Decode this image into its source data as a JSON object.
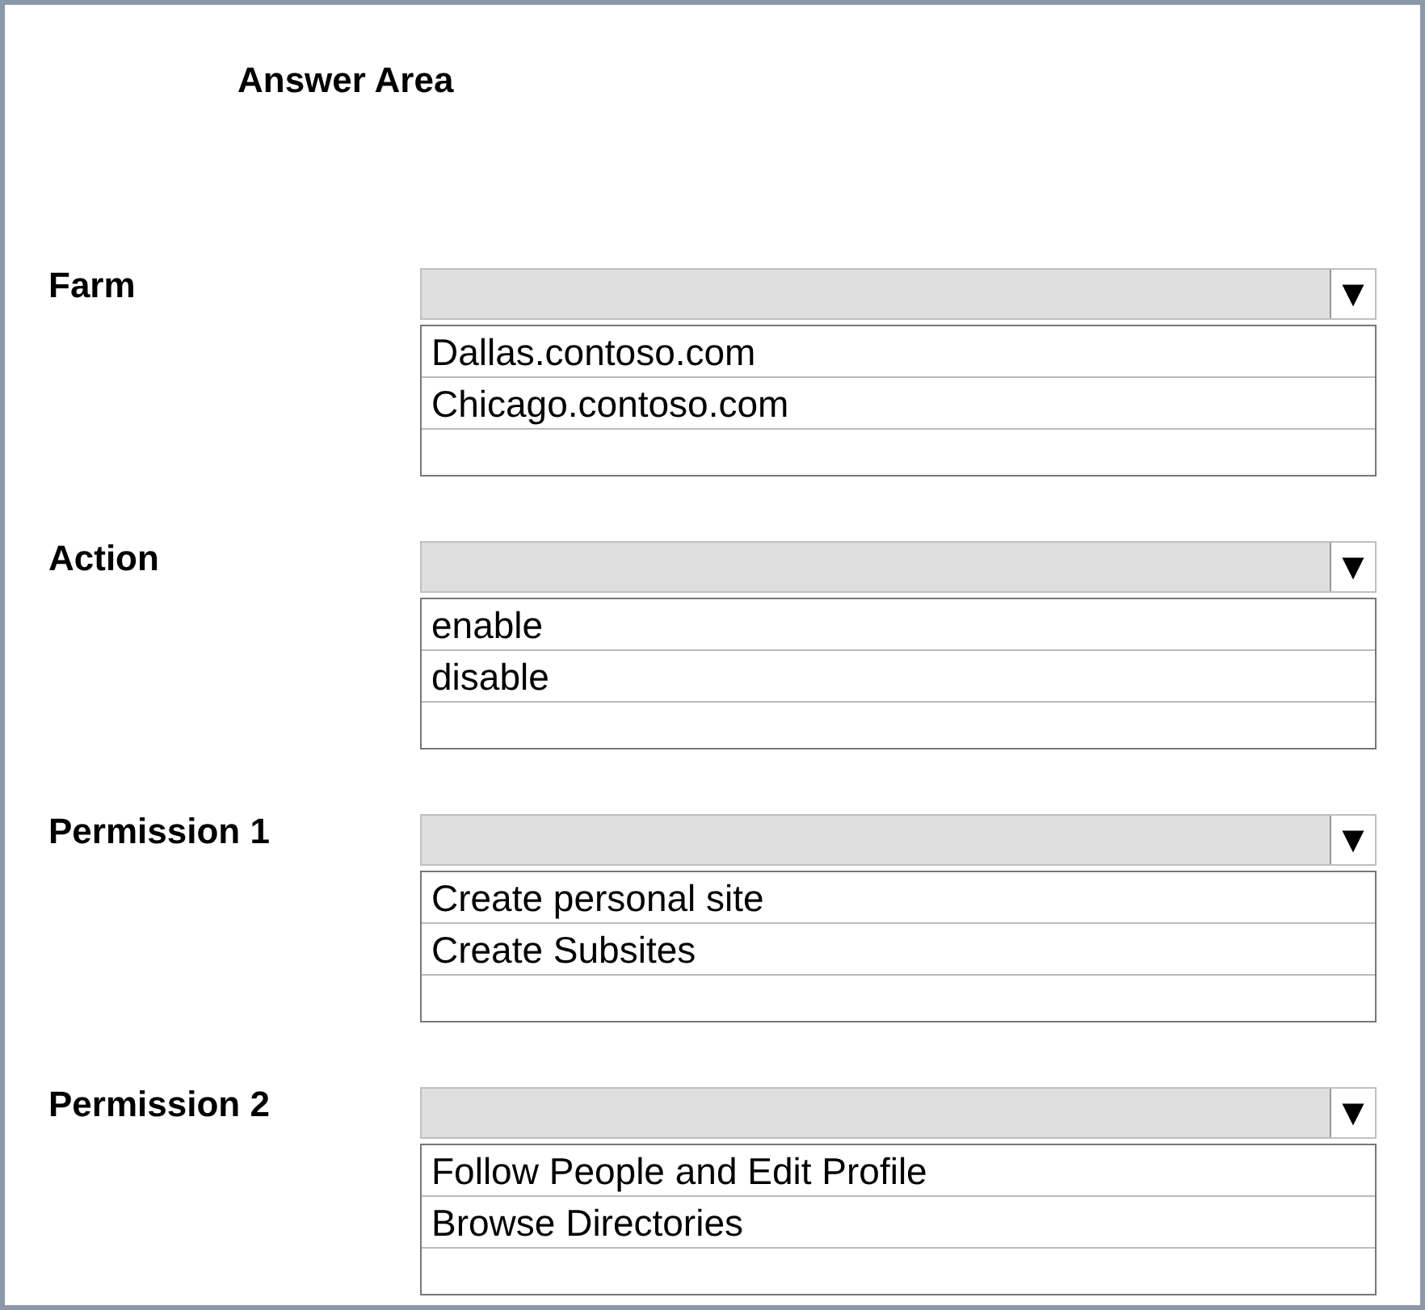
{
  "title": "Answer Area",
  "rows": [
    {
      "label": "Farm",
      "options": [
        "Dallas.contoso.com",
        "Chicago.contoso.com"
      ]
    },
    {
      "label": "Action",
      "options": [
        "enable",
        "disable"
      ]
    },
    {
      "label": "Permission 1",
      "options": [
        "Create personal site",
        "Create Subsites"
      ]
    },
    {
      "label": "Permission 2",
      "options": [
        "Follow People and Edit Profile",
        "Browse Directories"
      ]
    }
  ]
}
